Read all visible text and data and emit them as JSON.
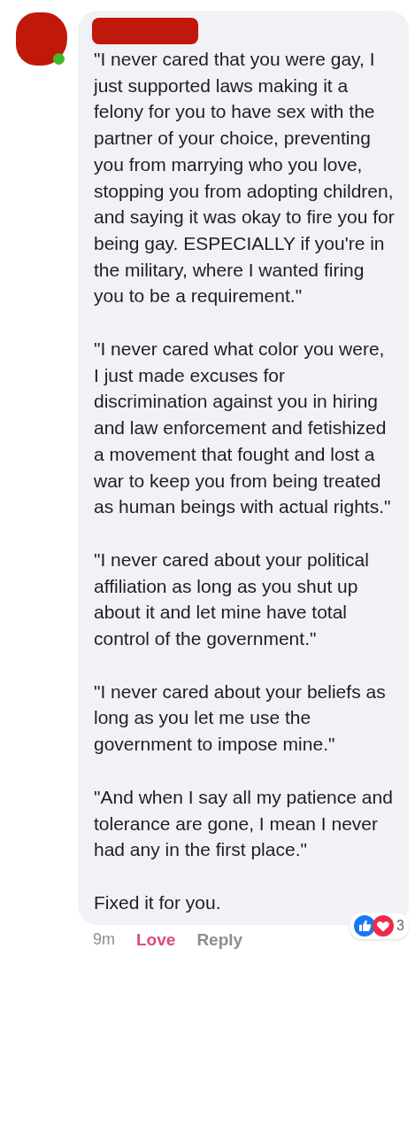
{
  "comment": {
    "author_online": true,
    "paragraphs": [
      "\"I never cared that you were gay, I just supported laws making it a felony for you to have sex with the partner of your choice, preventing you from marrying who you love, stopping you from adopting children, and saying it was okay to fire you for being gay. ESPECIALLY if you're in the military, where I wanted firing you to be a requirement.\"",
      "\"I never cared what color you were, I just made excuses for discrimination against you in hiring and law enforcement and fetishized a movement that fought and lost a war to keep you from being treated as human beings with actual rights.\"",
      "\"I never cared about your political affiliation as long as you shut up about it and let mine have total control of the government.\"",
      "\"I never cared about your beliefs as long as you let me use the government to impose mine.\"",
      "\"And when I say all my patience and tolerance are gone, I mean I never had any in the first place.\"",
      "Fixed it for you."
    ],
    "time": "9m",
    "actions": [
      {
        "label": "Love",
        "selected": true
      },
      {
        "label": "Reply",
        "selected": false
      }
    ],
    "reactions": {
      "count": "3"
    }
  }
}
